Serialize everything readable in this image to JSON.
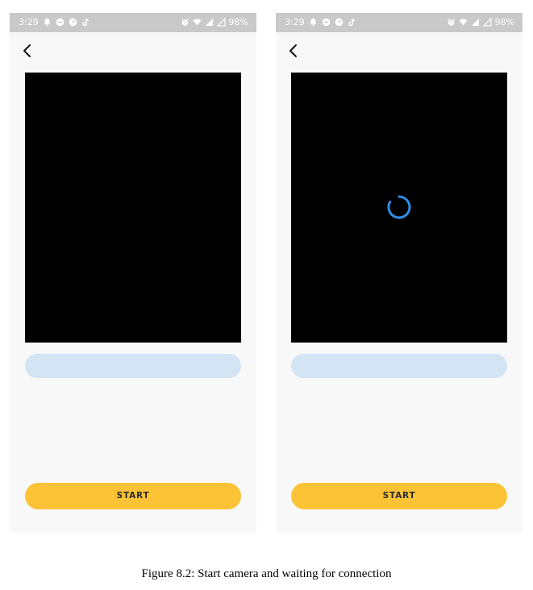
{
  "colors": {
    "status_bar": "#c9c9c9",
    "screen_background": "#f8f8f8",
    "camera_background": "#000000",
    "status_field": "#d3e4f5",
    "start_button": "#fdc336",
    "spinner": "#2f8de4"
  },
  "screens": [
    {
      "status_bar": {
        "time": "3:29",
        "left_icons": [
          "bell-icon",
          "minus-circle-icon",
          "gauge-icon",
          "tiktok-icon"
        ],
        "right_icons": [
          "alarm-icon",
          "wifi-icon",
          "signal-icon",
          "signal-icon"
        ],
        "battery": "98%"
      },
      "back_icon": "chevron-left-icon",
      "camera": {
        "loading": false
      },
      "status_text": "",
      "start_label": "START"
    },
    {
      "status_bar": {
        "time": "3:29",
        "left_icons": [
          "bell-icon",
          "minus-circle-icon",
          "gauge-icon",
          "tiktok-icon"
        ],
        "right_icons": [
          "alarm-icon",
          "wifi-icon",
          "signal-icon",
          "signal-icon"
        ],
        "battery": "98%"
      },
      "back_icon": "chevron-left-icon",
      "camera": {
        "loading": true,
        "spinner_icon": "loading-spinner-icon"
      },
      "status_text": "",
      "start_label": "START"
    }
  ],
  "caption": "Figure 8.2: Start camera and waiting for connection"
}
